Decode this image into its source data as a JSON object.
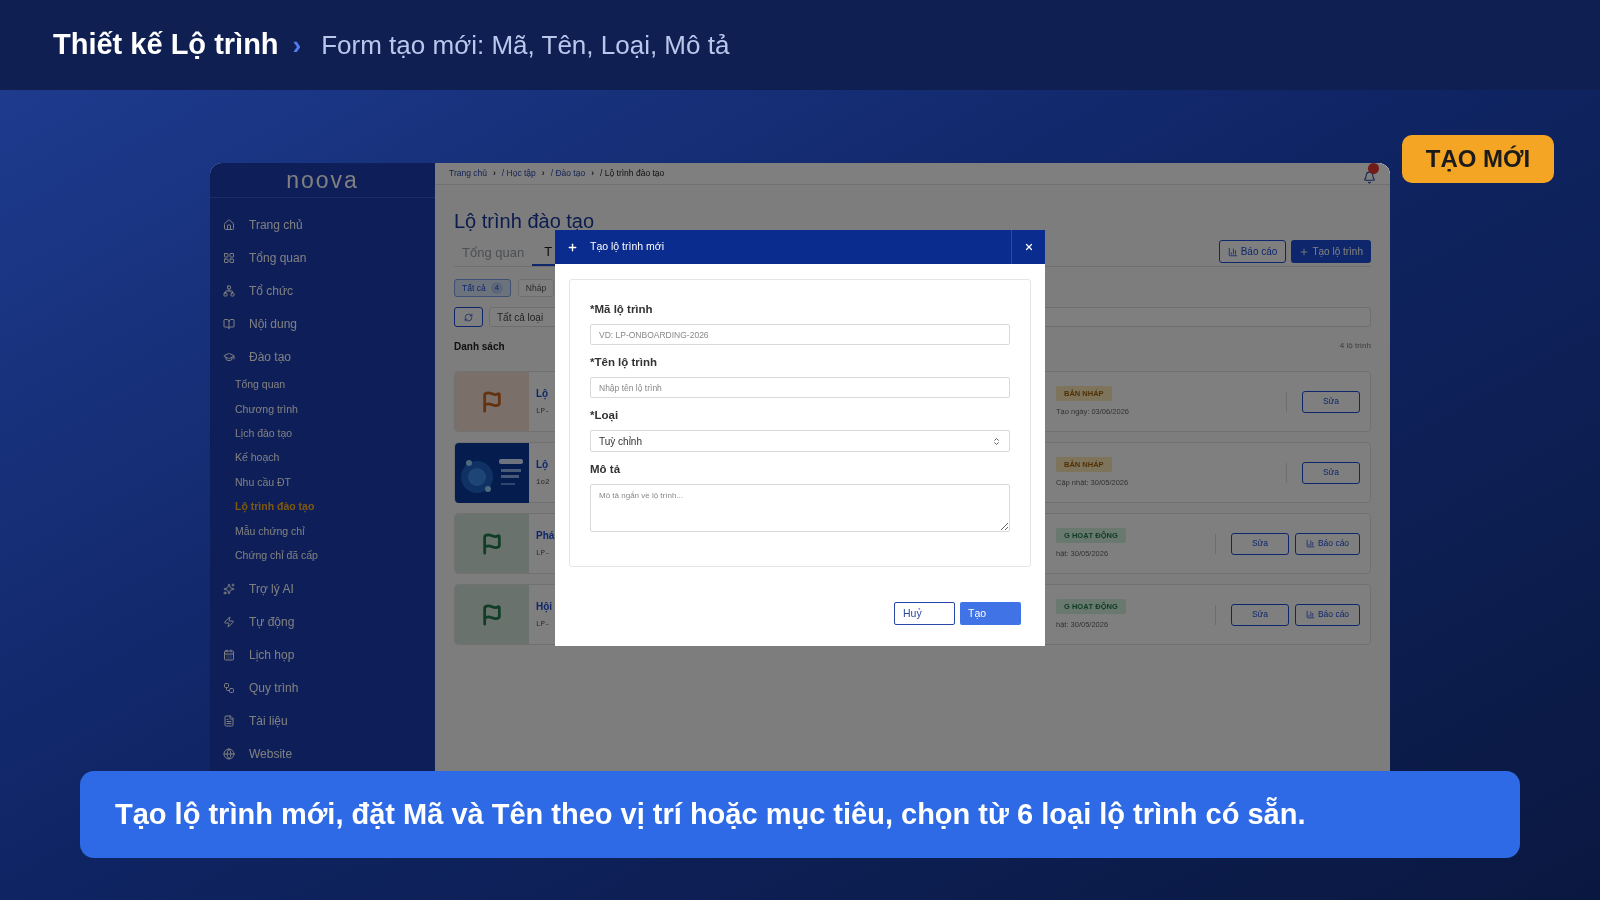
{
  "slide": {
    "title": "Thiết kế Lộ trình",
    "separator": "›",
    "subtitle": "Form tạo mới: Mã, Tên, Loại, Mô tả",
    "badge": "TẠO MỚI",
    "caption": "Tạo lộ trình mới, đặt Mã và Tên theo vị trí hoặc mục tiêu, chọn từ 6 loại lộ trình có sẵn."
  },
  "app": {
    "sidebar": {
      "logo": "noova",
      "items": [
        {
          "label": "Trang chủ",
          "selected": false
        },
        {
          "label": "Tổng quan",
          "selected": false
        },
        {
          "label": "Tổ chức",
          "selected": false
        },
        {
          "label": "Nội dung",
          "selected": false
        },
        {
          "label": "Đào tạo",
          "selected": false,
          "expanded": true,
          "children": [
            {
              "label": "Tổng quan",
              "selected": false
            },
            {
              "label": "Chương trình",
              "selected": false
            },
            {
              "label": "Lịch đào tạo",
              "selected": false
            },
            {
              "label": "Kế hoạch",
              "selected": false
            },
            {
              "label": "Nhu cầu ĐT",
              "selected": false
            },
            {
              "label": "Lộ trình đào tạo",
              "selected": true
            },
            {
              "label": "Mẫu chứng chỉ",
              "selected": false
            },
            {
              "label": "Chứng chỉ đã cấp",
              "selected": false
            }
          ]
        },
        {
          "label": "Trợ lý AI",
          "selected": false
        },
        {
          "label": "Tự động",
          "selected": false
        },
        {
          "label": "Lịch họp",
          "selected": false
        },
        {
          "label": "Quy trình",
          "selected": false
        },
        {
          "label": "Tài liệu",
          "selected": false
        },
        {
          "label": "Website",
          "selected": false
        }
      ]
    },
    "breadcrumb": [
      "Trang chủ",
      "›",
      "/ Học tập",
      "›",
      "/ Đào tạo",
      "›",
      "/ Lộ trình đào tạo"
    ],
    "page_title": "Lộ trình đào tạo",
    "tabs": [
      {
        "label": "Tổng quan",
        "selected": false
      },
      {
        "label": "T",
        "selected": true
      }
    ],
    "actions": [
      {
        "label": "Báo cáo",
        "kind": "outline"
      },
      {
        "label": "Tạo lộ trình",
        "kind": "primary"
      }
    ],
    "filters": [
      {
        "label": "Tất cả",
        "count": "4",
        "selected": true
      },
      {
        "label": "Nháp",
        "selected": false
      }
    ],
    "type_filter": {
      "value": "Tất cả loại"
    },
    "list": {
      "title": "Danh sách",
      "count": "4 lộ trình",
      "rows": [
        {
          "thumb": {
            "kind": "flag"
          },
          "title": "Lộ",
          "code": "LP-",
          "status": {
            "label": "BẢN NHÁP",
            "kind": "draft"
          },
          "date": "Tạo ngày: 03/06/2026",
          "buttons": [
            {
              "label": "Sửa",
              "kind": "edit"
            }
          ]
        },
        {
          "thumb": {
            "kind": "picture"
          },
          "title": "Lộ",
          "code": "1o2",
          "status": {
            "label": "BẢN NHÁP",
            "kind": "draft"
          },
          "date": "Cập nhật: 30/05/2026",
          "buttons": [
            {
              "label": "Sửa",
              "kind": "edit"
            }
          ]
        },
        {
          "thumb": {
            "kind": "flag"
          },
          "title": "Phá",
          "code": "LP-",
          "status": {
            "label": "G HOẠT ĐỘNG",
            "kind": "active"
          },
          "date": "hật: 30/05/2026",
          "buttons": [
            {
              "label": "Sửa",
              "kind": "edit"
            },
            {
              "label": "Báo cáo",
              "kind": "report"
            }
          ]
        },
        {
          "thumb": {
            "kind": "flag"
          },
          "title": "Hội",
          "code": "LP-",
          "status": {
            "label": "G HOẠT ĐỘNG",
            "kind": "active"
          },
          "date": "hật: 30/05/2026",
          "buttons": [
            {
              "label": "Sửa",
              "kind": "edit"
            },
            {
              "label": "Báo cáo",
              "kind": "report"
            }
          ]
        }
      ]
    }
  },
  "dialog": {
    "title": "Tạo lộ trình mới",
    "fields": [
      {
        "label": "*Mã lộ trình",
        "kind": "text",
        "placeholder": "VD: LP-ONBOARDING-2026"
      },
      {
        "label": "*Tên lộ trình",
        "kind": "text",
        "placeholder": "Nhập tên lộ trình"
      },
      {
        "label": "*Loại",
        "kind": "select",
        "value": "Tuỳ chỉnh"
      },
      {
        "label": "Mô tả",
        "kind": "textarea",
        "placeholder": "Mô tả ngắn về lộ trình..."
      }
    ],
    "buttons": [
      {
        "label": "Huỷ",
        "kind": "secondary"
      },
      {
        "label": "Tạo",
        "kind": "primary"
      }
    ]
  }
}
